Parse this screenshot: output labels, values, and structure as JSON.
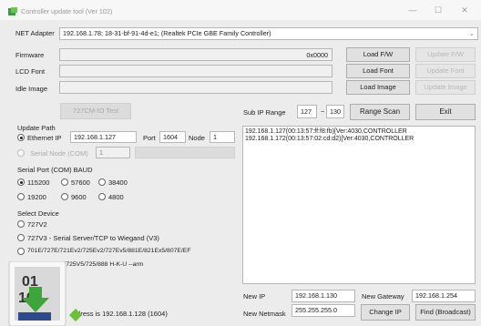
{
  "window": {
    "title": "Controller update tool (Ver 102)"
  },
  "net_adapter": {
    "label": "NET Adapter",
    "value": "192.168.1.78;  18-31-bf-91-4d-e1;  (Realtek PCIe GBE Family Controller)"
  },
  "firmware": {
    "label": "Firmware",
    "value": "0x0000",
    "load_label": "Load F/W",
    "update_label": "Update F/W"
  },
  "lcd_font": {
    "label": "LCD Font",
    "load_label": "Load Font",
    "update_label": "Update Font"
  },
  "idle_image": {
    "label": "Idle Image",
    "load_label": "Load Image",
    "update_label": "Update Image"
  },
  "io_test_label": "727CM-IO Test",
  "sub_ip": {
    "label": "Sub IP Range",
    "from": "127",
    "dash": "~",
    "to": "130",
    "scan_label": "Range Scan",
    "exit_label": "Exit"
  },
  "update_path": {
    "title": "Update Path",
    "ethernet_label": "Ethernet IP",
    "ip_value": "192.168.1.127",
    "port_label": "Port",
    "port_value": "1604",
    "node_label": "Node",
    "node_value": "1",
    "serial_label": "Serial Node (COM)",
    "serial_value": "1"
  },
  "baud": {
    "title": "Serial Port (COM) BAUD",
    "options": [
      "115200",
      "57600",
      "38400",
      "19200",
      "9600",
      "4800"
    ],
    "selected": "115200"
  },
  "device": {
    "title": "Select Device",
    "options": [
      "727V2",
      "727V3 - Serial Server/TCP to Wiegand (V3)",
      "701E/727E/721Ev2/725Ev2/727Ev5/881E/821Ex5/807E/EF",
      "725Ev3/7Ev3/725V5/725/888 H-K-U  --arm"
    ],
    "selected": ""
  },
  "scan_results": [
    "192.168.1.127(00:13:57:ff:f8:fb)[Ver:4030,CONTROLLER",
    "192.168.1.172(00:13:57:02:cd:d2)[Ver:4030,CONTROLLER"
  ],
  "status_text": "ddress is 192.168.1.128 (1604)",
  "new_ip": {
    "label": "New IP",
    "value": "192.168.1.130"
  },
  "new_gateway": {
    "label": "New Gateway",
    "value": "192.168.1.254"
  },
  "new_netmask": {
    "label": "New Netmask",
    "value": "255.255.255.0"
  },
  "change_ip_label": "Change IP",
  "find_label": "Find (Broadcast)",
  "titlebar_buttons": {
    "minimize": "—",
    "maximize": "☐",
    "close": "✕"
  }
}
